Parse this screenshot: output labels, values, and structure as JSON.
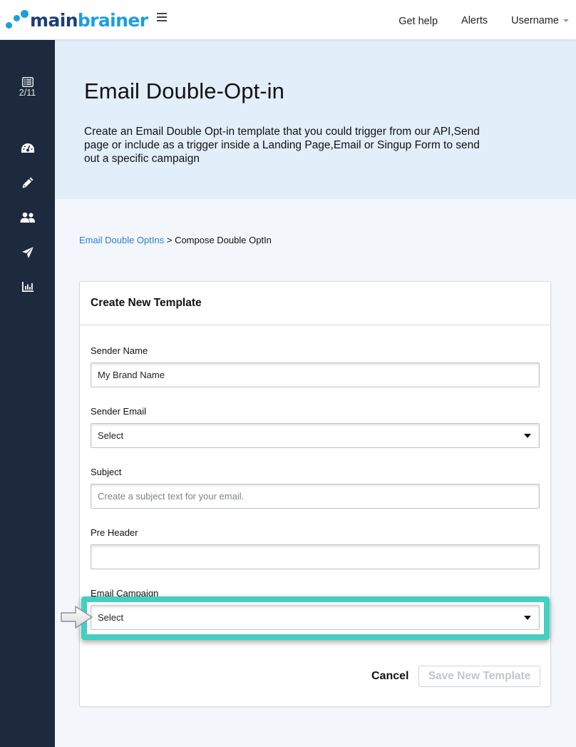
{
  "brand": {
    "name_part1": "main",
    "name_part2": "brainer",
    "color_primary": "#1d3c78",
    "color_accent": "#1a9ee0"
  },
  "topnav": {
    "menu_icon": "hamburger-icon",
    "links": [
      {
        "label": "Get help"
      },
      {
        "label": "Alerts"
      },
      {
        "label": "Username",
        "icon": "caret-down-icon"
      }
    ]
  },
  "sidebar": {
    "counter": {
      "icon": "list-icon",
      "label": "2/11"
    },
    "items": [
      {
        "icon": "dashboard-gauge-icon"
      },
      {
        "icon": "pencil-icon"
      },
      {
        "icon": "users-icon"
      },
      {
        "icon": "paper-plane-icon"
      },
      {
        "icon": "bar-chart-icon"
      }
    ],
    "bg_color": "#1d2a3e"
  },
  "hero": {
    "title": "Email Double-Opt-in",
    "description": "Create an Email Double Opt-in template that you could trigger from our API,Send page or include as a trigger inside a Landing Page,Email or Singup Form to send out a specific campaign",
    "bg_color": "#e2eefa"
  },
  "breadcrumb": {
    "link": "Email Double OptIns",
    "separator": " > ",
    "current": "Compose Double OptIn"
  },
  "form": {
    "title": "Create New Template",
    "fields": {
      "sender_name": {
        "label": "Sender Name",
        "value": "My Brand Name",
        "placeholder": ""
      },
      "sender_email": {
        "label": "Sender Email",
        "selected": "Select"
      },
      "subject": {
        "label": "Subject",
        "value": "",
        "placeholder": "Create a subject text for your email."
      },
      "pre_header": {
        "label": "Pre Header",
        "value": "",
        "placeholder": ""
      },
      "email_campaign": {
        "label": "Email Campaign",
        "selected": "Select"
      }
    },
    "cancel_label": "Cancel",
    "save_label": "Save New Template",
    "highlight_color": "#44cfc2"
  }
}
